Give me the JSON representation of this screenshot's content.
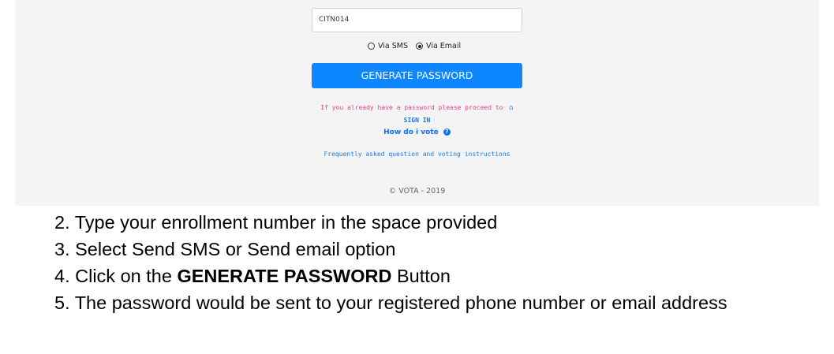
{
  "form": {
    "enrollment_value": "CITN014",
    "radio_sms_label": "Via SMS",
    "radio_email_label": "Via Email",
    "selected_option": "Via Email",
    "generate_label": "GENERATE PASSWORD",
    "already_text": "If you already have a password please proceed to",
    "signin_label": "SIGN IN",
    "how_vote_label": "How do i vote",
    "faq_label": "Frequently asked question and voting instructions",
    "copyright": "© VOTA - 2019"
  },
  "instructions": {
    "step2": "2. Type your enrollment number in the space provided",
    "step3": "3. Select Send SMS or Send email option",
    "step4_prefix": "4. Click on the",
    "step4_bold": "GENERATE PASSWORD",
    "step4_suffix": "Button",
    "step5": "5. The password would be sent to your registered phone number or email address"
  }
}
